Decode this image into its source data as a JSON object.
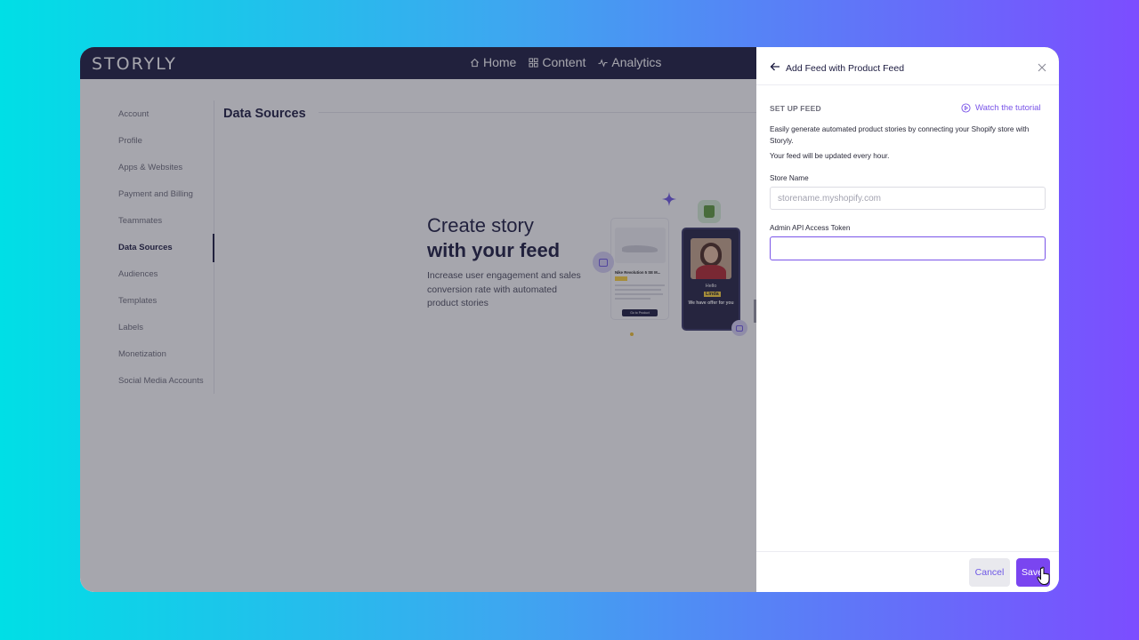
{
  "app": {
    "logo": "STORYLY"
  },
  "nav": {
    "items": [
      {
        "label": "Home",
        "icon": "home-icon"
      },
      {
        "label": "Content",
        "icon": "grid-icon"
      },
      {
        "label": "Analytics",
        "icon": "pulse-icon"
      }
    ]
  },
  "sidebar": {
    "items": [
      {
        "label": "Account",
        "active": false
      },
      {
        "label": "Profile",
        "active": false
      },
      {
        "label": "Apps & Websites",
        "active": false
      },
      {
        "label": "Payment and Billing",
        "active": false
      },
      {
        "label": "Teammates",
        "active": false
      },
      {
        "label": "Data Sources",
        "active": true
      },
      {
        "label": "Audiences",
        "active": false
      },
      {
        "label": "Templates",
        "active": false
      },
      {
        "label": "Labels",
        "active": false
      },
      {
        "label": "Monetization",
        "active": false
      },
      {
        "label": "Social Media Accounts",
        "active": false
      }
    ]
  },
  "main": {
    "title": "Data Sources",
    "hero": {
      "line1": "Create story",
      "line2": "with your feed",
      "description": "Increase user engagement and sales conversion rate with automated product stories"
    },
    "illustration": {
      "product_name": "Nike Revolution 5 SE M...",
      "product_button": "Go to Product",
      "story_hello": "Hello",
      "story_name": "Linda",
      "story_offer": "We have offer for you"
    }
  },
  "drawer": {
    "title": "Add Feed with Product Feed",
    "section_label": "SET UP FEED",
    "tutorial_label": "Watch the tutorial",
    "description": "Easily generate automated product stories by connecting your Shopify store with Storyly.",
    "update_note": "Your feed will be updated every hour.",
    "store_name": {
      "label": "Store Name",
      "placeholder": "storename.myshopify.com",
      "value": ""
    },
    "token": {
      "label": "Admin API Access Token",
      "placeholder": "",
      "value": ""
    },
    "cancel_label": "Cancel",
    "save_label": "Save"
  },
  "colors": {
    "nav_bg": "#1b1a3f",
    "accent": "#7a45f0",
    "link": "#7a55e8"
  }
}
